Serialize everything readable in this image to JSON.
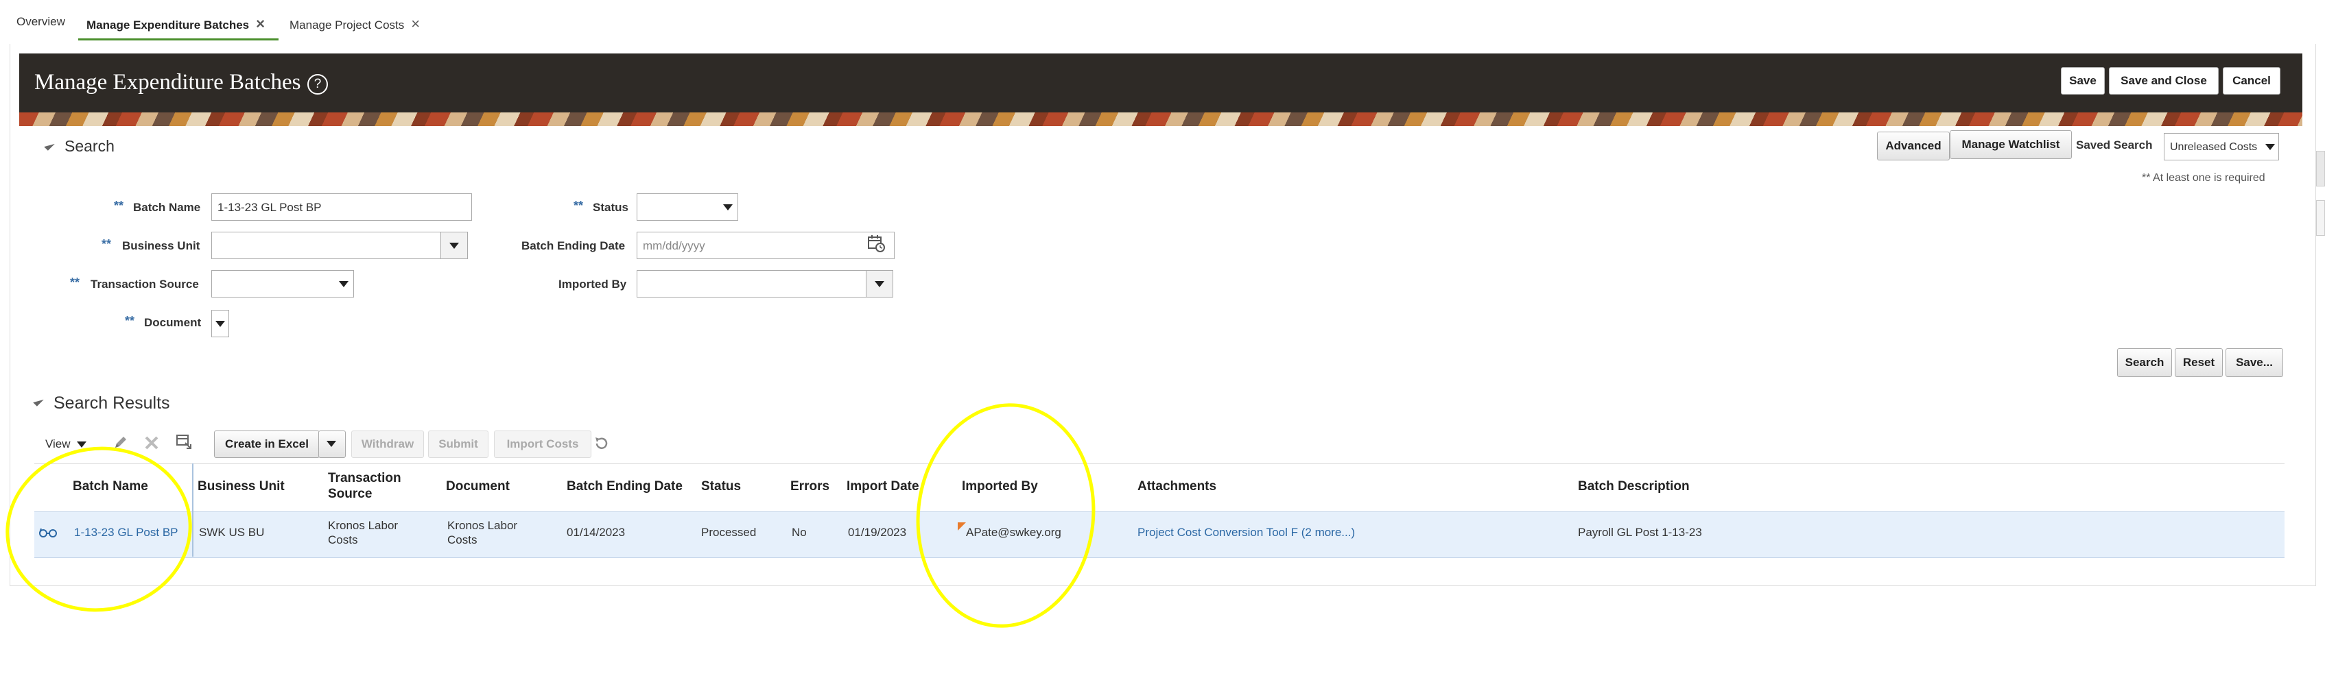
{
  "tabs": [
    {
      "label": "Overview"
    },
    {
      "label": "Manage Expenditure Batches"
    },
    {
      "label": "Manage Project Costs"
    }
  ],
  "tab_close_glyph": "×",
  "header": {
    "title": "Manage Expenditure Batches",
    "help_glyph": "?",
    "save_label": "Save",
    "save_close_label": "Save and Close",
    "cancel_label": "Cancel"
  },
  "search": {
    "title": "Search",
    "advanced_label": "Advanced",
    "watchlist_label": "Manage Watchlist",
    "saved_search_label": "Saved Search",
    "saved_search_value": "Unreleased Costs",
    "required_note": "** At least one is required",
    "required_marker": "**",
    "fields": {
      "batch_name_label": "Batch Name",
      "batch_name_value": "1-13-23 GL Post BP",
      "business_unit_label": "Business Unit",
      "transaction_source_label": "Transaction Source",
      "document_label": "Document",
      "status_label": "Status",
      "batch_ending_date_label": "Batch Ending Date",
      "batch_ending_date_placeholder": "mm/dd/yyyy",
      "imported_by_label": "Imported By"
    },
    "search_button": "Search",
    "reset_button": "Reset",
    "save_button": "Save..."
  },
  "results": {
    "title": "Search Results",
    "toolbar": {
      "view_label": "View",
      "create_excel_label": "Create in Excel",
      "withdraw_label": "Withdraw",
      "submit_label": "Submit",
      "import_costs_label": "Import Costs"
    },
    "columns": [
      "Batch Name",
      "Business Unit",
      "Transaction Source",
      "Document",
      "Batch Ending Date",
      "Status",
      "Errors",
      "Import Date",
      "Imported By",
      "Attachments",
      "Batch Description"
    ],
    "rows": [
      {
        "batch_name": "1-13-23 GL Post BP",
        "business_unit": "SWK US BU",
        "transaction_source": "Kronos Labor Costs",
        "document": "Kronos Labor Costs",
        "batch_ending_date": "01/14/2023",
        "status": "Processed",
        "errors": "No",
        "import_date": "01/19/2023",
        "imported_by": "APate@swkey.org",
        "attachments": "Project Cost Conversion Tool F (2 more...)",
        "batch_description": "Payroll GL Post 1-13-23"
      }
    ]
  },
  "colors": {
    "header_bg": "#2e2a26",
    "link": "#2a67a4",
    "selected_row": "#e6f0fb",
    "highlight": "#ffff00",
    "active_tab_underline": "#4a8f2c"
  }
}
